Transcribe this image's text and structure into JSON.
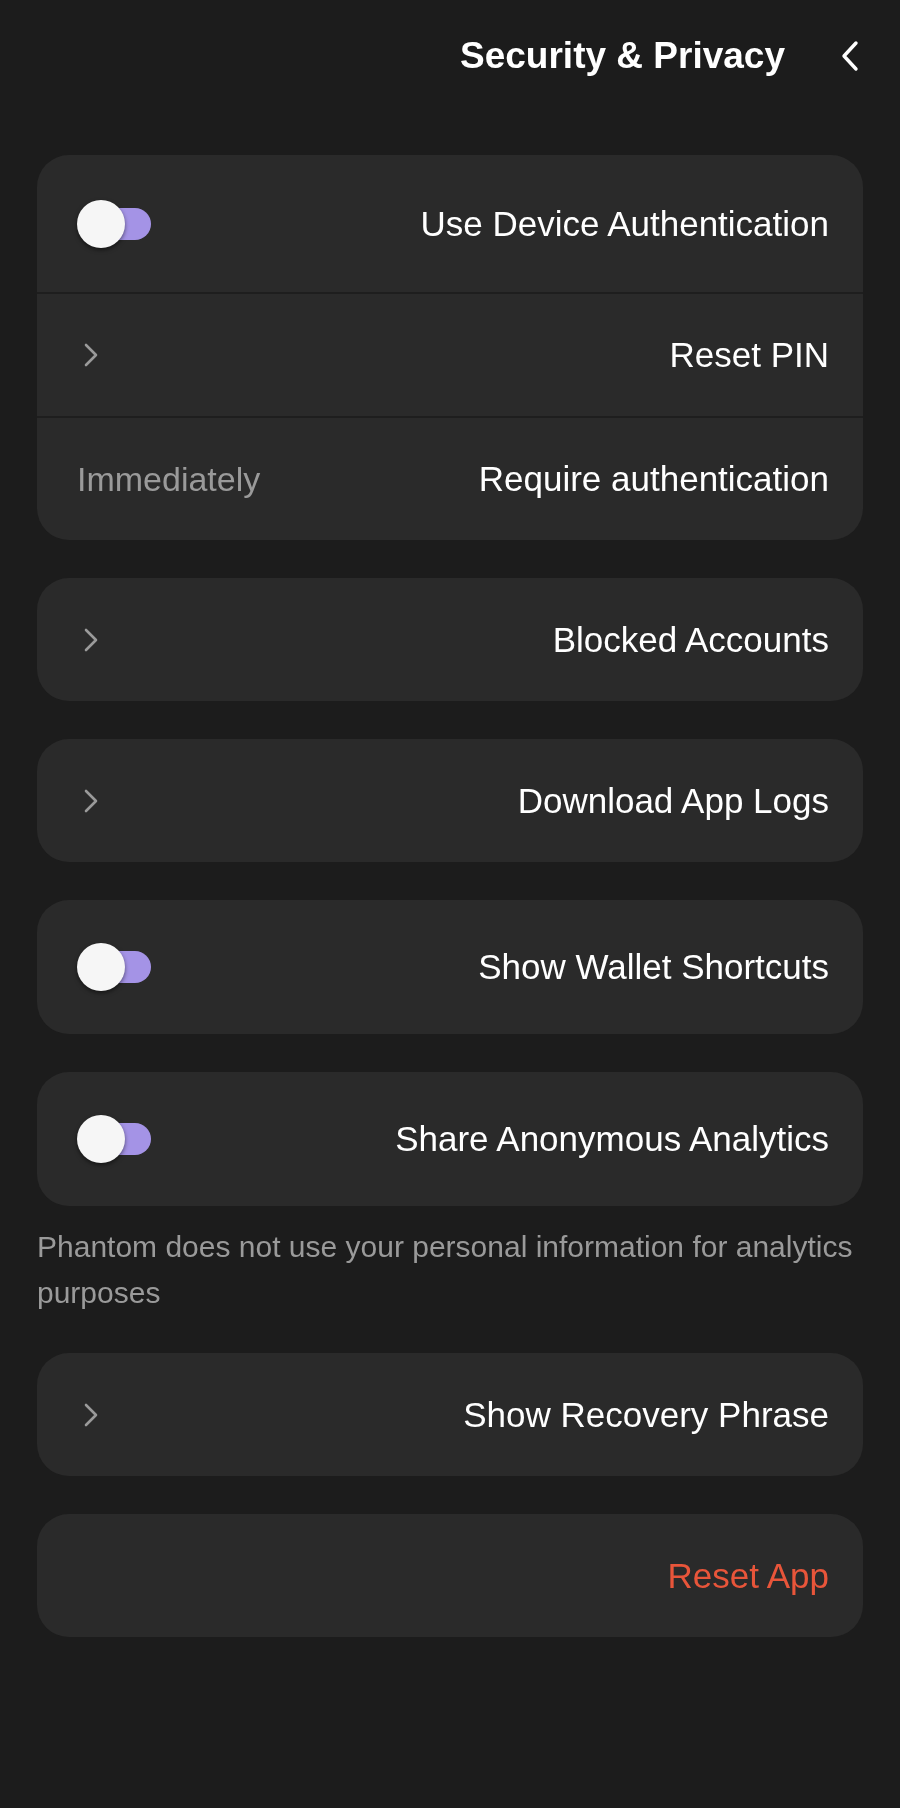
{
  "header": {
    "title": "Security & Privacy"
  },
  "groups": [
    {
      "rows": [
        {
          "kind": "toggle",
          "label": "Use Device Authentication",
          "checked": false
        },
        {
          "kind": "link",
          "label": "Reset PIN"
        },
        {
          "kind": "value",
          "label": "Require authentication",
          "value": "Immediately"
        }
      ]
    },
    {
      "rows": [
        {
          "kind": "link",
          "label": "Blocked Accounts"
        }
      ]
    },
    {
      "rows": [
        {
          "kind": "link",
          "label": "Download App Logs"
        }
      ]
    },
    {
      "rows": [
        {
          "kind": "toggle",
          "label": "Show Wallet Shortcuts",
          "checked": false
        }
      ]
    },
    {
      "rows": [
        {
          "kind": "toggle",
          "label": "Share Anonymous Analytics",
          "checked": false
        }
      ],
      "note": "Phantom does not use your personal information for analytics purposes"
    },
    {
      "rows": [
        {
          "kind": "link",
          "label": "Show Recovery Phrase"
        }
      ]
    },
    {
      "rows": [
        {
          "kind": "danger",
          "label": "Reset App"
        }
      ]
    }
  ]
}
